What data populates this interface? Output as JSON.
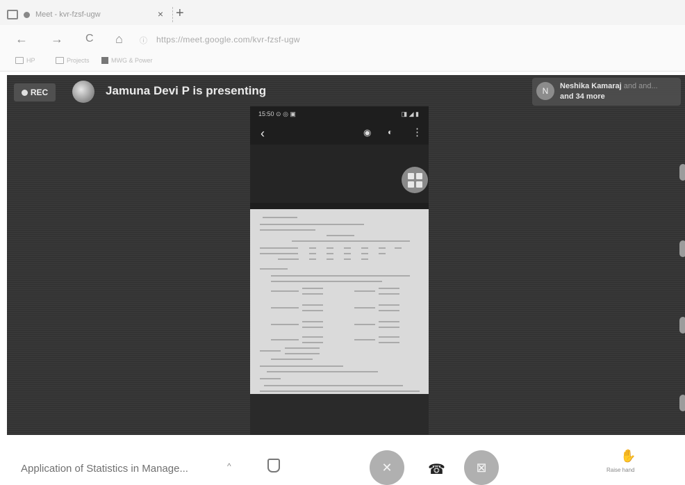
{
  "browser": {
    "tab_title": "Meet - kvr-fzsf-ugw",
    "tab_close": "×",
    "new_tab": "+",
    "nav": {
      "back": "←",
      "forward": "→",
      "reload": "C",
      "home": "⌂"
    },
    "url": "https://meet.google.com/kvr-fzsf-ugw",
    "bookmarks": [
      "HP",
      "Projects",
      "MWG & Power"
    ]
  },
  "meeting": {
    "rec_label": "REC",
    "presenting_text": "Jamuna Devi P is presenting",
    "participants": {
      "avatar_initial": "N",
      "name": "Neshika Kamaraj",
      "name_rest": " and and...",
      "more": "and 34 more"
    }
  },
  "phone": {
    "status_time": "15:50 ⊙ ◎ ▣",
    "status_icons": "◨ ◢ ▮",
    "back": "‹",
    "eye": "◉",
    "adjust": "◐",
    "more": "⋮"
  },
  "controls": {
    "meeting_title": "Application of Statistics in Manage...",
    "caret": "^",
    "mic_icon": "✕",
    "hangup_icon": "☎",
    "camera_icon": "⊠",
    "raise_hand_icon": "✋",
    "raise_hand_label": "Raise hand"
  },
  "colors": {
    "stage": "#383838",
    "control_button": "#b0b0b0"
  }
}
